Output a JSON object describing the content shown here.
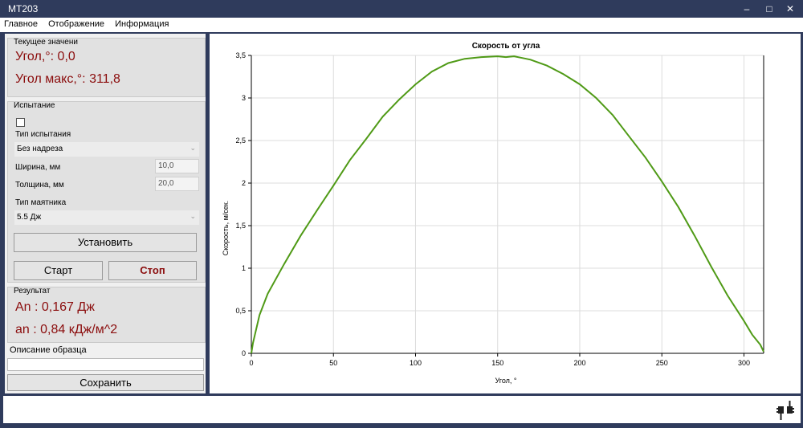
{
  "window": {
    "title": "MT203",
    "minimize": "–",
    "maximize": "□",
    "close": "✕"
  },
  "menu": [
    "Главное",
    "Отображение",
    "Информация"
  ],
  "current": {
    "group_label": "Текущее значени",
    "angle_text": "Угол,°: 0,0",
    "angle_max_text": "Угол макс,°: 311,8"
  },
  "test": {
    "group_label": "Испытание",
    "checkbox_checked": false,
    "type_label": "Тип испытания",
    "type_value": "Без надреза",
    "width_label": "Ширина, мм",
    "width_value": "10,0",
    "thickness_label": "Толщина, мм",
    "thickness_value": "20,0",
    "pendulum_label": "Тип маятника",
    "pendulum_value": "5.5 Дж",
    "set_button": "Установить",
    "start_button": "Старт",
    "stop_button": "Стоп"
  },
  "result": {
    "group_label": "Результат",
    "an_text": "An  : 0,167 Дж",
    "an2_text": "an  : 0,84 кДж/м^2"
  },
  "sample": {
    "label": "Описание  образца",
    "value": "",
    "save_button": "Сохранить"
  },
  "status": {
    "icon": "plug-icon"
  },
  "chart_data": {
    "type": "line",
    "title": "Скорость от угла",
    "xlabel": "Угол, °",
    "ylabel": "Скорость, м/сек.",
    "xlim": [
      0,
      312
    ],
    "ylim": [
      0,
      3.5
    ],
    "grid": true,
    "line_color": "#4f9a16",
    "x_ticks": [
      0,
      50,
      100,
      150,
      200,
      250,
      300
    ],
    "y_ticks": [
      "0",
      "0,5",
      "1",
      "1,5",
      "2",
      "2,5",
      "3",
      "3,5"
    ],
    "y_tick_values": [
      0,
      0.5,
      1,
      1.5,
      2,
      2.5,
      3,
      3.5
    ],
    "series": [
      {
        "x": [
          0,
          1,
          5,
          10,
          20,
          30,
          40,
          50,
          60,
          70,
          80,
          90,
          100,
          110,
          120,
          130,
          140,
          150,
          155,
          160,
          165,
          170,
          180,
          190,
          200,
          210,
          220,
          230,
          240,
          250,
          260,
          270,
          280,
          290,
          300,
          305,
          310,
          312
        ],
        "y": [
          0,
          0.12,
          0.45,
          0.7,
          1.05,
          1.38,
          1.68,
          1.97,
          2.27,
          2.52,
          2.78,
          2.98,
          3.16,
          3.31,
          3.41,
          3.46,
          3.48,
          3.49,
          3.48,
          3.49,
          3.47,
          3.45,
          3.38,
          3.28,
          3.16,
          3.0,
          2.8,
          2.55,
          2.3,
          2.02,
          1.72,
          1.38,
          1.02,
          0.68,
          0.38,
          0.22,
          0.1,
          0.02
        ]
      }
    ]
  }
}
